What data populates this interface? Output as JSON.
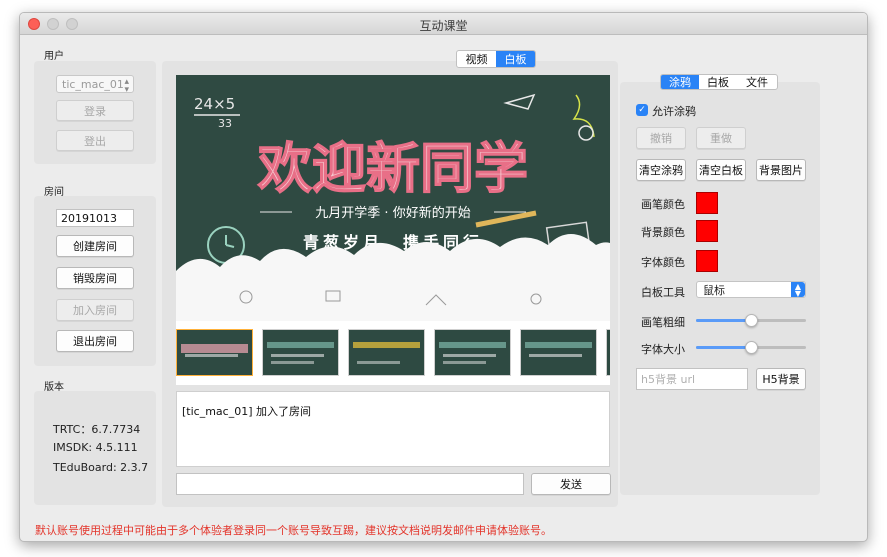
{
  "window": {
    "title": "互动课堂"
  },
  "user_group": {
    "label": "用户",
    "account": "tic_mac_01",
    "login": "登录",
    "logout": "登出"
  },
  "room_group": {
    "label": "房间",
    "room_id": "20191013",
    "create": "创建房间",
    "destroy": "销毁房间",
    "join": "加入房间",
    "quit": "退出房间"
  },
  "version_group": {
    "label": "版本",
    "trtc": "TRTC：6.7.7734",
    "imsdk": "IMSDK:   4.5.111",
    "teduboard": "TEduBoard:   2.3.7"
  },
  "main_tabs": {
    "video": "视频",
    "board": "白板",
    "active": "board"
  },
  "board_slide": {
    "main_title": "欢迎新同学",
    "subtitle": "九月开学季 · 你好新的开始",
    "slogan": "青葱岁月，携手同行",
    "math": "24×5",
    "math_result": "33"
  },
  "log": {
    "lines": [
      "[tic_mac_01] 加入了房间"
    ]
  },
  "chat": {
    "input_value": "",
    "send": "发送"
  },
  "right_tabs": {
    "doodle": "涂鸦",
    "board": "白板",
    "file": "文件",
    "active": "doodle"
  },
  "doodle": {
    "allow_label": "允许涂鸦",
    "allow_checked": true,
    "undo": "撤销",
    "redo": "重做",
    "clear_doodle": "清空涂鸦",
    "clear_board": "清空白板",
    "bg_image": "背景图片",
    "pen_color_label": "画笔颜色",
    "bg_color_label": "背景颜色",
    "font_color_label": "字体颜色",
    "pen_color": "#ff0000",
    "bg_color": "#ff0000",
    "font_color": "#ff0000",
    "tool_label": "白板工具",
    "tool_value": "鼠标",
    "pen_width_label": "画笔粗细",
    "pen_width_level": 0.5,
    "font_size_label": "字体大小",
    "font_size_level": 0.5,
    "h5_placeholder": "h5背景 url",
    "h5_button": "H5背景"
  },
  "notice": "默认账号使用过程中可能由于多个体验者登录同一个账号导致互踢，建议按文档说明发邮件申请体验账号。"
}
